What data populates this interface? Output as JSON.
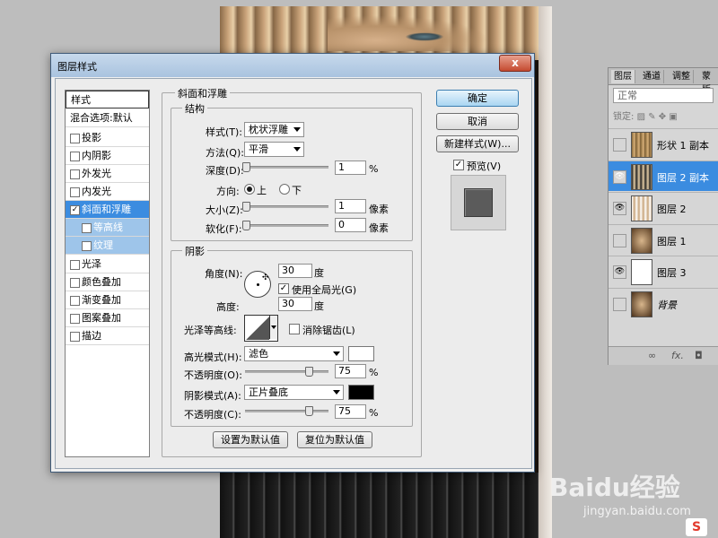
{
  "dialog": {
    "title": "图层样式",
    "close_label": "x"
  },
  "styles_list": {
    "header": "样式",
    "blend_options": "混合选项:默认",
    "items": [
      {
        "label": "投影",
        "checked": false
      },
      {
        "label": "内阴影",
        "checked": false
      },
      {
        "label": "外发光",
        "checked": false
      },
      {
        "label": "内发光",
        "checked": false
      },
      {
        "label": "斜面和浮雕",
        "checked": true
      },
      {
        "label": "等高线",
        "checked": false
      },
      {
        "label": "纹理",
        "checked": false
      },
      {
        "label": "光泽",
        "checked": false
      },
      {
        "label": "颜色叠加",
        "checked": false
      },
      {
        "label": "渐变叠加",
        "checked": false
      },
      {
        "label": "图案叠加",
        "checked": false
      },
      {
        "label": "描边",
        "checked": false
      }
    ]
  },
  "bevel": {
    "section_title": "斜面和浮雕",
    "structure_title": "结构",
    "style_label": "样式(T):",
    "style_value": "枕状浮雕",
    "technique_label": "方法(Q):",
    "technique_value": "平滑",
    "depth_label": "深度(D):",
    "depth_value": "1",
    "depth_unit": "%",
    "direction_label": "方向:",
    "direction_up": "上",
    "direction_down": "下",
    "size_label": "大小(Z):",
    "size_value": "1",
    "size_unit": "像素",
    "soften_label": "软化(F):",
    "soften_value": "0",
    "soften_unit": "像素"
  },
  "shading": {
    "title": "阴影",
    "angle_label": "角度(N):",
    "angle_value": "30",
    "angle_unit": "度",
    "global_light_label": "使用全局光(G)",
    "altitude_label": "高度:",
    "altitude_value": "30",
    "altitude_unit": "度",
    "gloss_label": "光泽等高线:",
    "antialias_label": "消除锯齿(L)",
    "highlight_mode_label": "高光模式(H):",
    "highlight_mode_value": "滤色",
    "highlight_color": "#ffffff",
    "highlight_opacity_label": "不透明度(O):",
    "highlight_opacity_value": "75",
    "highlight_opacity_unit": "%",
    "shadow_mode_label": "阴影模式(A):",
    "shadow_mode_value": "正片叠底",
    "shadow_color": "#000000",
    "shadow_opacity_label": "不透明度(C):",
    "shadow_opacity_value": "75",
    "shadow_opacity_unit": "%",
    "set_default_label": "设置为默认值",
    "reset_default_label": "复位为默认值"
  },
  "buttons": {
    "ok": "确定",
    "cancel": "取消",
    "new_style": "新建样式(W)...",
    "preview_label": "预览(V)"
  },
  "layers_panel": {
    "tabs": [
      "图层",
      "通道",
      "调整",
      "蒙版"
    ],
    "blend_mode": "正常",
    "lock_label": "锁定:",
    "layers": [
      {
        "name": "形状 1 副本",
        "visible": false,
        "selected": false
      },
      {
        "name": "图层 2 副本",
        "visible": true,
        "selected": true
      },
      {
        "name": "图层 2",
        "visible": true,
        "selected": false
      },
      {
        "name": "图层 1",
        "visible": false,
        "selected": false
      },
      {
        "name": "图层 3",
        "visible": true,
        "selected": false
      },
      {
        "name": "背景",
        "visible": false,
        "selected": false
      }
    ],
    "footer_icons": [
      "link-icon",
      "fx-icon",
      "mask-icon"
    ],
    "fx_label": "fx."
  },
  "watermark": {
    "logo": "Baidu经验",
    "url": "jingyan.baidu.com",
    "badge": "S"
  },
  "colors": {
    "selection_blue": "#3b8ce0",
    "sub_blue": "#9ec5ea",
    "preview_swatch": "#5b5b5b"
  }
}
